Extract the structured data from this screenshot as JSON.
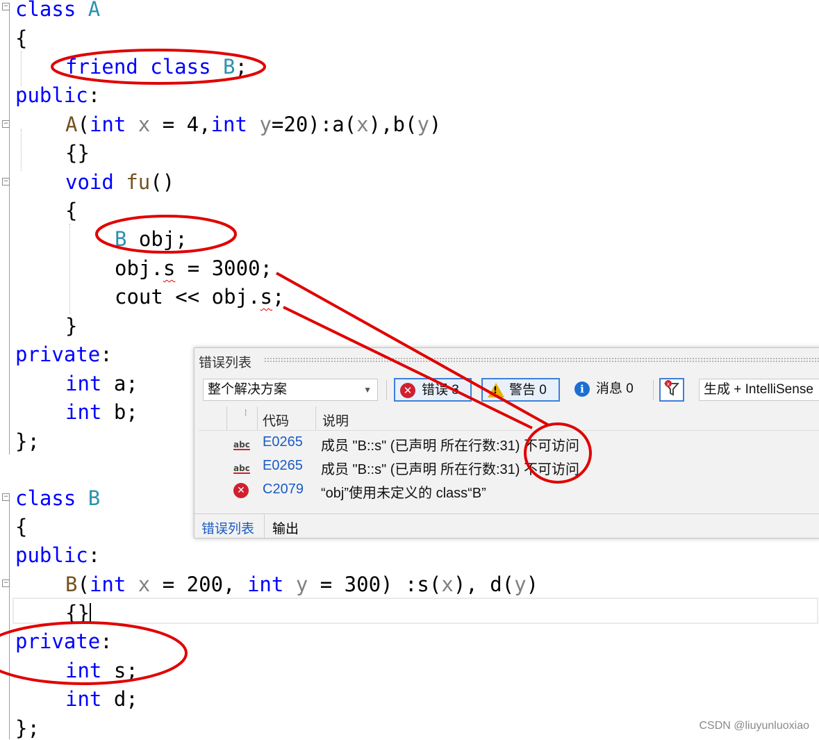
{
  "code": {
    "class_a": {
      "header_kw": "class",
      "header_name": "A",
      "open_brace": "{",
      "friend_kw1": "friend",
      "friend_kw2": "class",
      "friend_name": "B",
      "friend_end": ";",
      "public_kw": "public",
      "colon": ":",
      "ctor_name": "A",
      "ctor_p1": "(",
      "ctor_int1": "int",
      "ctor_x": "x",
      "ctor_mid1": " = 4,",
      "ctor_int2": "int",
      "ctor_y": "y",
      "ctor_mid2": "=20):a(",
      "ctor_x2": "x",
      "ctor_mid3": "),b(",
      "ctor_y2": "y",
      "ctor_end": ")",
      "ctor_body": "{}",
      "void_kw": "void",
      "fu_name": "fu",
      "fu_parens": "()",
      "fu_open": "{",
      "decl_type": "B",
      "decl_var": " obj;",
      "assign_obj": "obj.",
      "assign_s": "s",
      "assign_rest": " = 3000;",
      "cout_text": "cout << obj.",
      "cout_s": "s",
      "cout_end": ";",
      "fu_close": "}",
      "private_kw": "private",
      "int_a_kw": "int",
      "int_a_var": " a;",
      "int_b_kw": "int",
      "int_b_var": " b;",
      "close": "};"
    },
    "class_b": {
      "header_kw": "class",
      "header_name": "B",
      "open_brace": "{",
      "public_kw": "public",
      "colon": ":",
      "ctor_name": "B",
      "ctor_p1": "(",
      "ctor_int1": "int",
      "ctor_x": "x",
      "ctor_mid1": " = 200, ",
      "ctor_int2": "int",
      "ctor_y": "y",
      "ctor_mid2": " = 300) :s(",
      "ctor_x2": "x",
      "ctor_mid3": "), d(",
      "ctor_y2": "y",
      "ctor_end": ")",
      "ctor_body": "{}",
      "private_kw": "private",
      "int_s_kw": "int",
      "int_s_var": " s;",
      "int_d_kw": "int",
      "int_d_var": " d;",
      "close": "};"
    }
  },
  "error_list": {
    "title": "错误列表",
    "scope_value": "整个解决方案",
    "errors_label": "错误 3",
    "warnings_label": "警告 0",
    "messages_label": "消息 0",
    "build_filter_value": "生成 + IntelliSense",
    "columns": {
      "code": "代码",
      "description": "说明"
    },
    "rows": [
      {
        "icon": "intellisense-error-icon",
        "code": "E0265",
        "description": "成员 \"B::s\" (已声明 所在行数:31) 不可访问"
      },
      {
        "icon": "intellisense-error-icon",
        "code": "E0265",
        "description": "成员 \"B::s\" (已声明 所在行数:31) 不可访问"
      },
      {
        "icon": "error-icon",
        "code": "C2079",
        "description": "“obj”使用未定义的 class“B”"
      }
    ],
    "tabs": {
      "error_list": "错误列表",
      "output": "输出"
    }
  },
  "colors": {
    "keyword": "#0000ff",
    "type": "#2b91af",
    "parameter": "#808080",
    "function": "#74531f",
    "annotation_red": "#e00000",
    "link_blue": "#1a5bc4"
  },
  "watermark": "CSDN @liuyunluoxiao"
}
